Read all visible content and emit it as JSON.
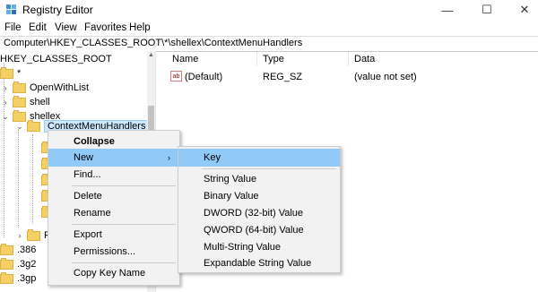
{
  "window": {
    "title": "Registry Editor",
    "minimize_glyph": "—",
    "maximize_glyph": "☐",
    "close_glyph": "✕"
  },
  "menubar": {
    "items": [
      "File",
      "Edit",
      "View",
      "Favorites",
      "Help"
    ]
  },
  "address": "Computer\\HKEY_CLASSES_ROOT\\*\\shellex\\ContextMenuHandlers",
  "tree": {
    "root": "HKEY_CLASSES_ROOT",
    "star": "*",
    "open_with_list": "OpenWithList",
    "shell": "shell",
    "shellex": "shellex",
    "context_menu_handlers": "ContextMenuHandlers",
    "p_partial": "P",
    "ext_386": ".386",
    "ext_3g2": ".3g2",
    "ext_3gp": ".3gp"
  },
  "list": {
    "columns": [
      "Name",
      "Type",
      "Data"
    ],
    "rows": [
      {
        "name": "(Default)",
        "type": "REG_SZ",
        "data": "(value not set)",
        "icon": "ab"
      }
    ]
  },
  "context_menu": {
    "items": [
      "Collapse",
      "New",
      "Find...",
      "Delete",
      "Rename",
      "Export",
      "Permissions...",
      "Copy Key Name"
    ],
    "submenu_arrow": "›"
  },
  "new_submenu": {
    "items": [
      "Key",
      "String Value",
      "Binary Value",
      "DWORD (32-bit) Value",
      "QWORD (64-bit) Value",
      "Multi-String Value",
      "Expandable String Value"
    ]
  },
  "colors": {
    "highlight": "#91c9f7",
    "selection": "#cce8ff",
    "folder": "#f4cf63"
  }
}
